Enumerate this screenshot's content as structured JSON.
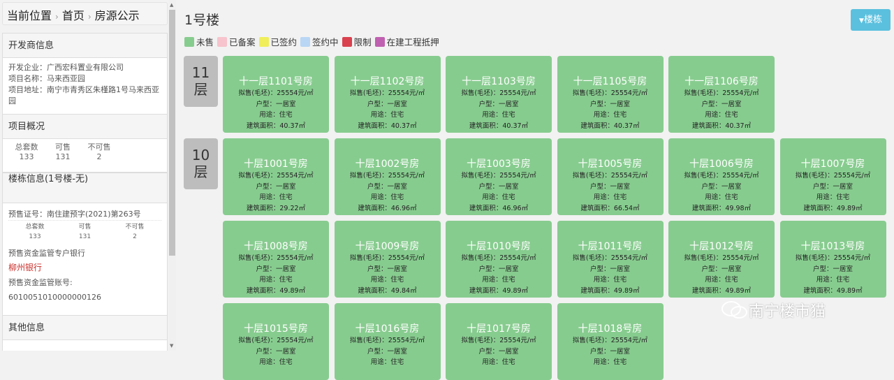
{
  "breadcrumb": [
    "当前位置",
    "首页",
    "房源公示"
  ],
  "developer": {
    "heading": "开发商信息",
    "company": "开发企业：广西宏科置业有限公司",
    "project": "项目名称：马来西亚园",
    "address": "项目地址：南宁市青秀区朱槿路1号马来西亚园"
  },
  "overview": {
    "heading": "项目概况",
    "labels": [
      "总套数",
      "可售",
      "不可售"
    ],
    "values": [
      "133",
      "131",
      "2"
    ]
  },
  "building": {
    "heading": "楼栋信息(1号楼-无)",
    "permit": "预售证号：南住建预字(2021)第263号",
    "labels": [
      "总套数",
      "可售",
      "不可售"
    ],
    "values": [
      "133",
      "131",
      "2"
    ],
    "bank_label": "预售资金监管专户银行",
    "bank": "柳州银行",
    "account_label": "预售资金监管账号:",
    "account": "6010051010000000126"
  },
  "other": {
    "heading": "其他信息"
  },
  "main": {
    "title": "1号楼",
    "filter_label": "楼栋",
    "watermark": "南宁楼市猫"
  },
  "legend": [
    {
      "label": "未售",
      "color": "#87cc8f"
    },
    {
      "label": "已备案",
      "color": "#f7c3cc"
    },
    {
      "label": "已签约",
      "color": "#f0ee5a"
    },
    {
      "label": "签约中",
      "color": "#b9d6f5"
    },
    {
      "label": "限制",
      "color": "#d9414e"
    },
    {
      "label": "在建工程抵押",
      "color": "#c060b0"
    }
  ],
  "floors": [
    {
      "label": [
        "11",
        "层"
      ],
      "rooms": [
        {
          "title": "十一层1101号房",
          "area": "40.37"
        },
        {
          "title": "十一层1102号房",
          "area": "40.37"
        },
        {
          "title": "十一层1103号房",
          "area": "40.37"
        },
        {
          "title": "十一层1105号房",
          "area": "40.37"
        },
        {
          "title": "十一层1106号房",
          "area": "40.37"
        }
      ]
    },
    {
      "label": [
        "10",
        "层"
      ],
      "rooms": [
        {
          "title": "十层1001号房",
          "area": "29.22"
        },
        {
          "title": "十层1002号房",
          "area": "46.96"
        },
        {
          "title": "十层1003号房",
          "area": "46.96"
        },
        {
          "title": "十层1005号房",
          "area": "66.54"
        },
        {
          "title": "十层1006号房",
          "area": "49.98"
        },
        {
          "title": "十层1007号房",
          "area": "49.89"
        },
        {
          "title": "十层1008号房",
          "area": "49.89"
        },
        {
          "title": "十层1009号房",
          "area": "49.84"
        },
        {
          "title": "十层1010号房",
          "area": "49.89"
        },
        {
          "title": "十层1011号房",
          "area": "49.89"
        },
        {
          "title": "十层1012号房",
          "area": "49.89"
        },
        {
          "title": "十层1013号房",
          "area": "49.89"
        },
        {
          "title": "十层1015号房",
          "area": ""
        },
        {
          "title": "十层1016号房",
          "area": ""
        },
        {
          "title": "十层1017号房",
          "area": ""
        },
        {
          "title": "十层1018号房",
          "area": ""
        }
      ]
    }
  ],
  "room_common": {
    "price": "拟售(毛坯)：25554元/㎡",
    "type": "户型：一居室",
    "use": "用途：住宅",
    "area_prefix": "建筑面积："
  }
}
